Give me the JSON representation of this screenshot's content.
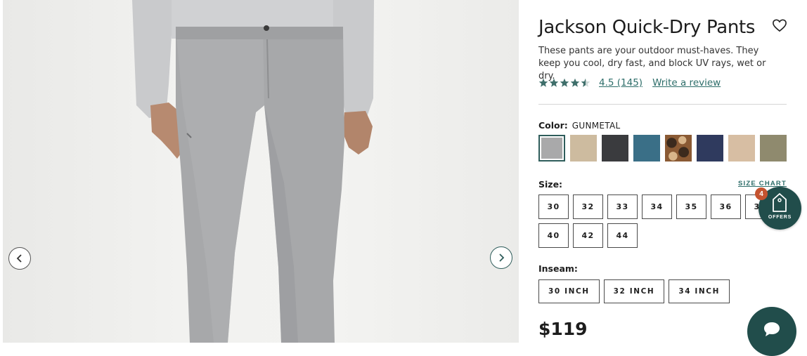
{
  "product": {
    "title": "Jackson Quick-Dry Pants",
    "description": "These pants are your outdoor must-haves. They keep you cool, dry fast, and block UV rays, wet or dry.",
    "rating": {
      "stars": 4.5,
      "link_text": "4.5 (145)",
      "write_review": "Write a review"
    },
    "color": {
      "label": "Color:",
      "selected": "GUNMETAL",
      "swatches": [
        "#a9a9aa",
        "#cdbb9f",
        "#3a3b3e",
        "#3a6f87",
        "camo",
        "#2f3a5e",
        "#d7bea3",
        "#8f8a6e"
      ]
    },
    "size": {
      "label": "Size:",
      "chart_link": "SIZE CHART",
      "options": [
        "30",
        "32",
        "33",
        "34",
        "35",
        "36",
        "38",
        "40",
        "42",
        "44"
      ]
    },
    "inseam": {
      "label": "Inseam:",
      "options": [
        "30 INCH",
        "32 INCH",
        "34 INCH"
      ]
    },
    "price": "$119"
  },
  "gallery": {
    "prev_icon": "chevron-left-icon",
    "next_icon": "chevron-right-icon"
  },
  "offers": {
    "label": "OFFERS",
    "count": "4",
    "icon": "tag-icon"
  },
  "chat": {
    "icon": "chat-bubble-icon"
  },
  "colors": {
    "accent": "#2e6e6a",
    "widget": "#214d4b",
    "badge": "#c5532f"
  }
}
